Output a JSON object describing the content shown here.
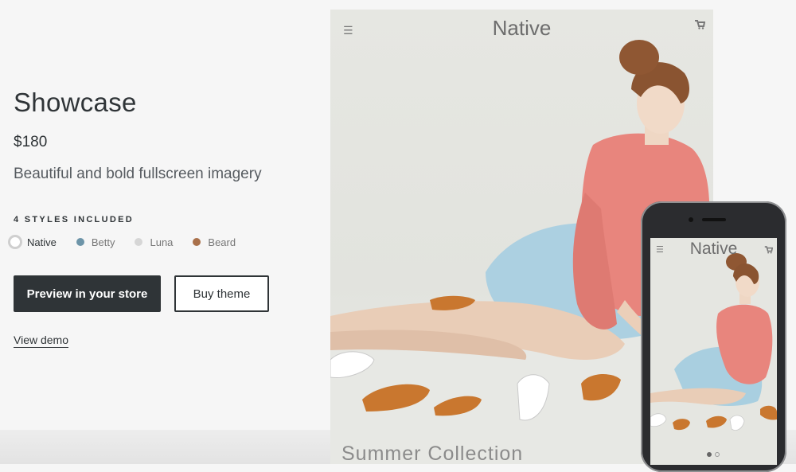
{
  "product": {
    "title": "Showcase",
    "price": "$180",
    "tagline": "Beautiful and bold fullscreen imagery"
  },
  "styles": {
    "heading": "4 STYLES INCLUDED",
    "options": [
      {
        "label": "Native",
        "color": "#ffffff",
        "selected": true
      },
      {
        "label": "Betty",
        "color": "#6d94a8"
      },
      {
        "label": "Luna",
        "color": "#d6d6d6"
      },
      {
        "label": "Beard",
        "color": "#a9704a"
      }
    ]
  },
  "actions": {
    "preview_label": "Preview in your store",
    "buy_label": "Buy theme",
    "demo_label": "View demo"
  },
  "desktop_preview": {
    "brand": "Native",
    "collection_label": "Summer Collection",
    "menu_icon": "hamburger-icon",
    "cart_icon": "cart-icon"
  },
  "mobile_preview": {
    "brand": "Native"
  },
  "colors": {
    "primary": "#2f3437",
    "background": "#f6f6f6",
    "sweater": "#e8857d",
    "skirt": "#a9cfe0"
  }
}
